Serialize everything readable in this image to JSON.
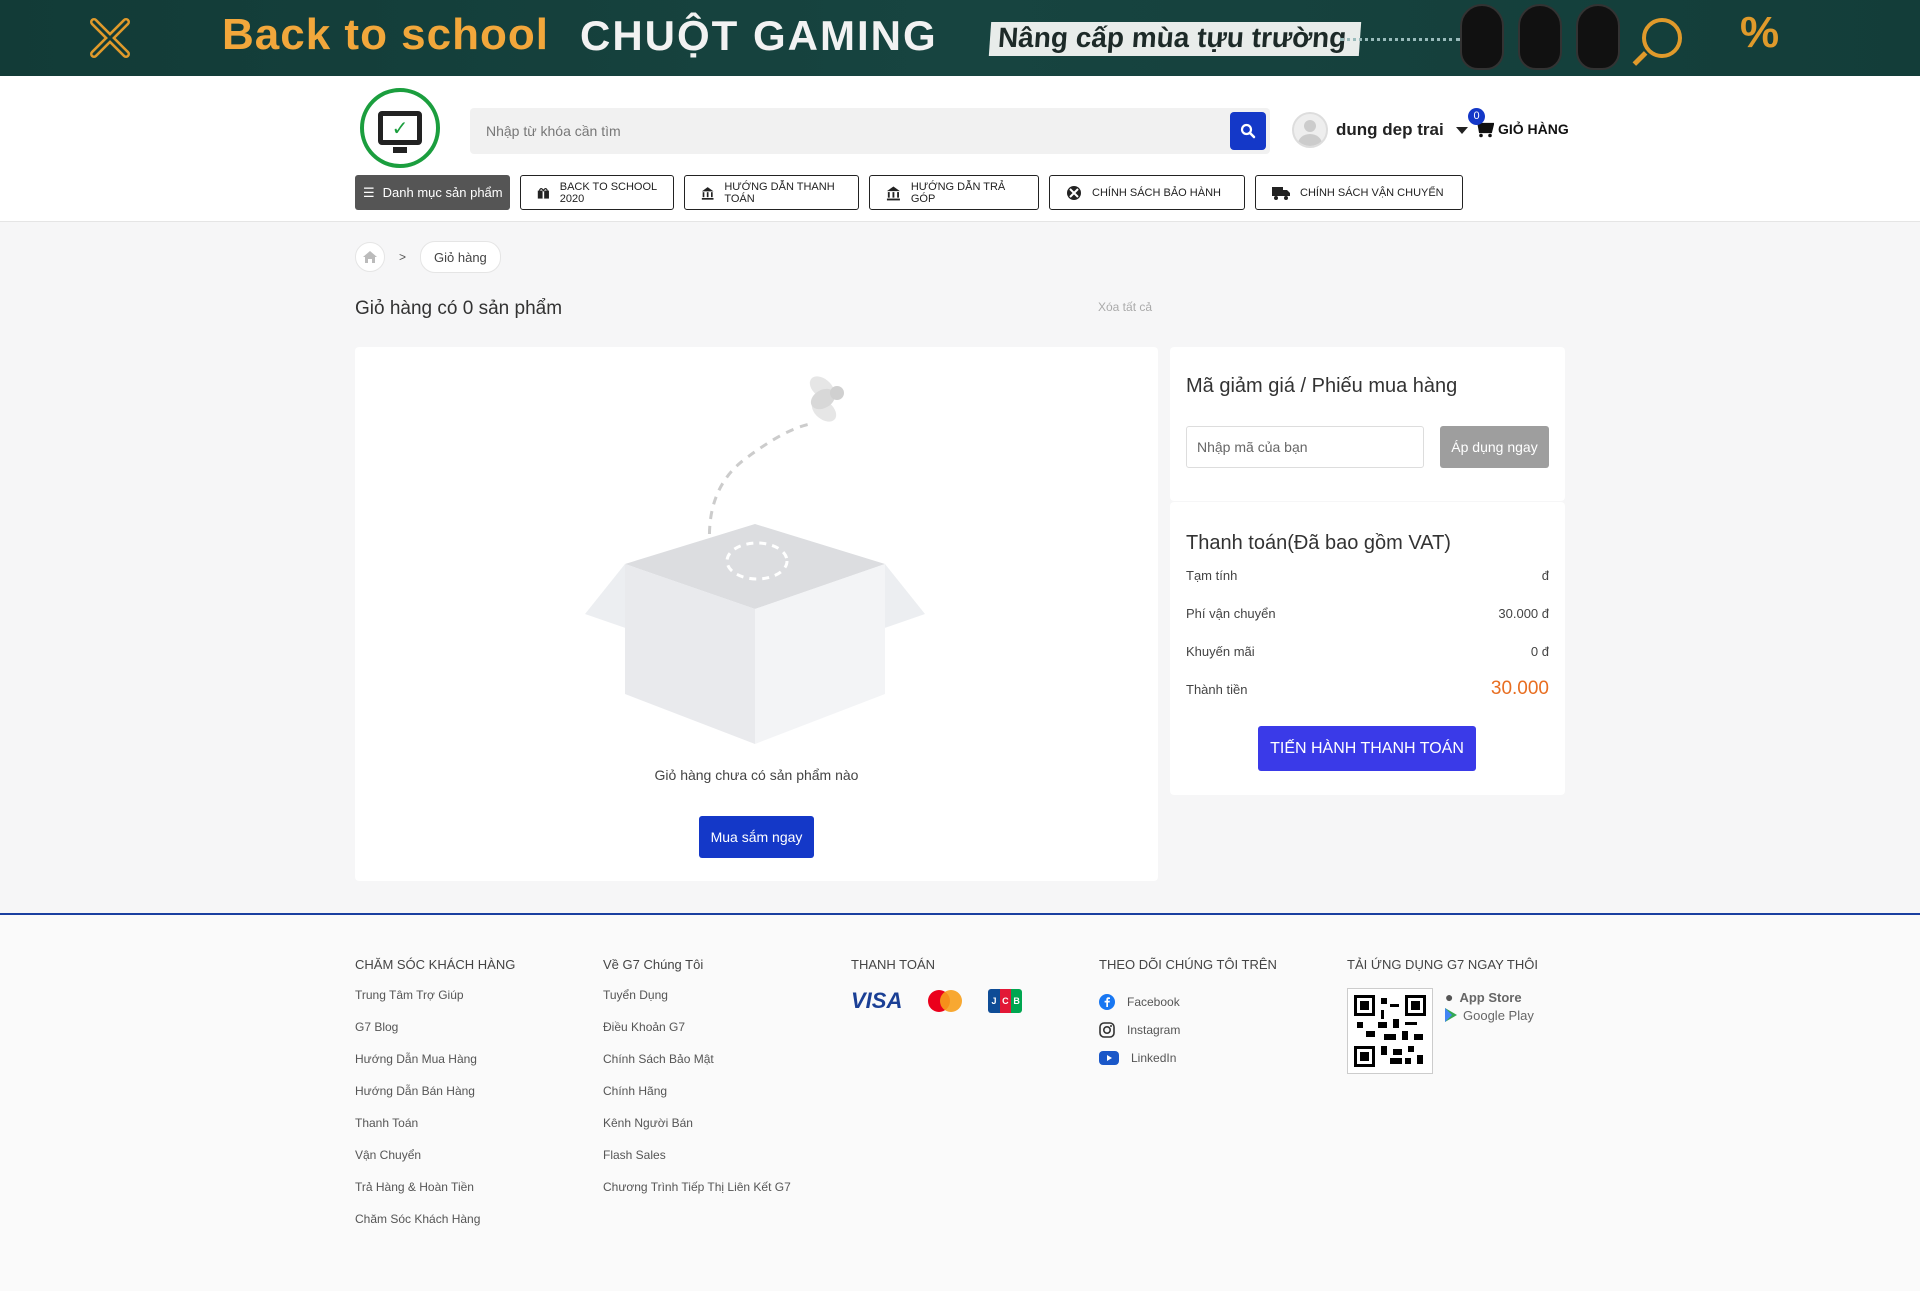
{
  "banner": {
    "title1": "Back to school",
    "title2": "CHUỘT GAMING",
    "title3": "Nâng cấp mùa tựu trường"
  },
  "header": {
    "search_placeholder": "Nhập từ khóa cần tìm",
    "username": "dung dep trai",
    "cart_count": "0",
    "cart_label": "GIỎ HÀNG"
  },
  "nav": {
    "category": "Danh mục sản phẩm",
    "items": [
      "BACK TO SCHOOL 2020",
      "HƯỚNG DẪN THANH TOÁN",
      "HƯỚNG DẪN TRẢ GÓP",
      "CHÍNH SÁCH BẢO HÀNH",
      "CHÍNH SÁCH VẬN CHUYỂN"
    ]
  },
  "breadcrumb": {
    "current": "Giỏ hàng"
  },
  "cart": {
    "title": "Giỏ hàng có 0 sản phẩm",
    "clear_all": "Xóa tất cả",
    "empty_text": "Giỏ hàng chưa có sản phẩm nào",
    "shop_now": "Mua sắm ngay"
  },
  "coupon": {
    "title": "Mã giảm giá / Phiếu mua hàng",
    "placeholder": "Nhập mã của bạn",
    "apply": "Áp dụng ngay"
  },
  "payment": {
    "title": "Thanh toán(Đã bao gồm VAT)",
    "rows": [
      {
        "label": "Tạm tính",
        "value": "đ"
      },
      {
        "label": "Phí vận chuyển",
        "value": "30.000 đ"
      },
      {
        "label": "Khuyến mãi",
        "value": "0 đ"
      },
      {
        "label": "Thành tiền",
        "value": "30.000"
      }
    ],
    "checkout": "TIẾN HÀNH THANH TOÁN"
  },
  "footer": {
    "customer_care": {
      "title": "CHĂM SÓC KHÁCH HÀNG",
      "links": [
        "Trung Tâm Trợ Giúp",
        "G7 Blog",
        "Hướng Dẫn Mua Hàng",
        "Hướng Dẫn Bán Hàng",
        "Thanh Toán",
        "Vận Chuyển",
        "Trả Hàng & Hoàn Tiền",
        "Chăm Sóc Khách Hàng"
      ]
    },
    "about": {
      "title": "Về G7 Chúng Tôi",
      "links": [
        "Tuyển Dụng",
        "Điều Khoản G7",
        "Chính Sách Bảo Mật",
        "Chính Hãng",
        "Kênh Người Bán",
        "Flash Sales",
        "Chương Trình Tiếp Thị Liên Kết G7"
      ]
    },
    "payment": {
      "title": "THANH TOÁN",
      "visa": "VISA",
      "mastercard": "mastercard",
      "jcb": "JCB"
    },
    "follow": {
      "title": "THEO DÕI CHÚNG TÔI TRÊN",
      "links": [
        "Facebook",
        "Instagram",
        "LinkedIn"
      ]
    },
    "app": {
      "title": "TẢI ỨNG DỤNG G7 NGAY THÔI",
      "app_store": "App Store",
      "google_play": "Google Play"
    }
  },
  "colors": {
    "accent": "#1438c8",
    "checkout": "#3a3ae8",
    "total": "#e86e21",
    "logo": "#1b9e3e"
  }
}
